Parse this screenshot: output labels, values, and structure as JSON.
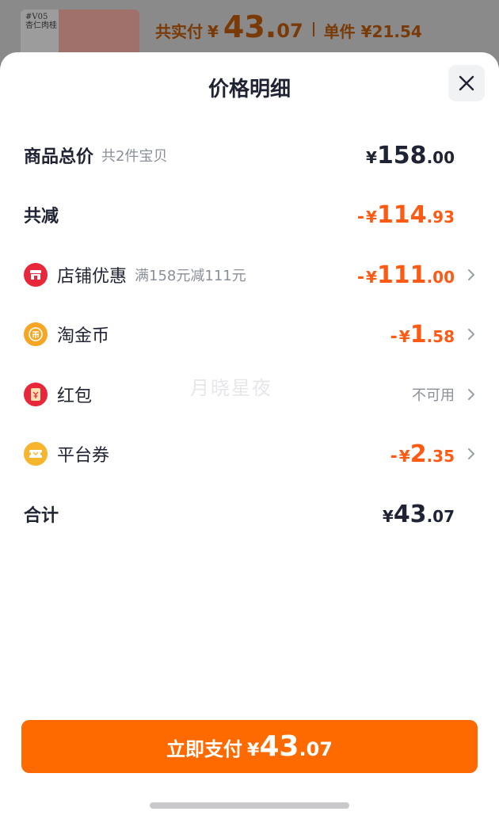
{
  "background": {
    "thumb_tag": "#V05\n杏仁肉桂",
    "total_label": "共实付",
    "currency": "¥",
    "total_int": "43.",
    "total_dec": "07",
    "unit_label": "单件 ¥21.54"
  },
  "sheet": {
    "title": "价格明细",
    "close_icon": "close-icon",
    "watermark": "月晓星夜",
    "rows": {
      "subtotal": {
        "label": "商品总价",
        "sub": "共2件宝贝",
        "currency": "¥",
        "int": "158",
        "dec": ".00"
      },
      "discount": {
        "label": "共减",
        "sign": "-",
        "currency": "¥",
        "int": "114",
        "dec": ".93"
      },
      "shop_coupon": {
        "icon": "shop-icon",
        "label": "店铺优惠",
        "sub": "满158元减111元",
        "sign": "-",
        "currency": "¥",
        "int": "111",
        "dec": ".00"
      },
      "gold_coin": {
        "icon": "coin-icon",
        "label": "淘金币",
        "sign": "-",
        "currency": "¥",
        "int": "1",
        "dec": ".58"
      },
      "red_packet": {
        "icon": "red-packet-icon",
        "label": "红包",
        "status": "不可用"
      },
      "platform_coupon": {
        "icon": "ticket-icon",
        "label": "平台券",
        "sign": "-",
        "currency": "¥",
        "int": "2",
        "dec": ".35"
      },
      "total": {
        "label": "合计",
        "currency": "¥",
        "int": "43",
        "dec": ".07"
      }
    },
    "pay_button": {
      "label": "立即支付",
      "currency": "¥",
      "int": "43",
      "dec": ".07"
    }
  },
  "colors": {
    "accent": "#ff6a00",
    "discount_text": "#ff5a14",
    "text_primary": "#1f2333",
    "text_secondary": "#8a8f99"
  }
}
